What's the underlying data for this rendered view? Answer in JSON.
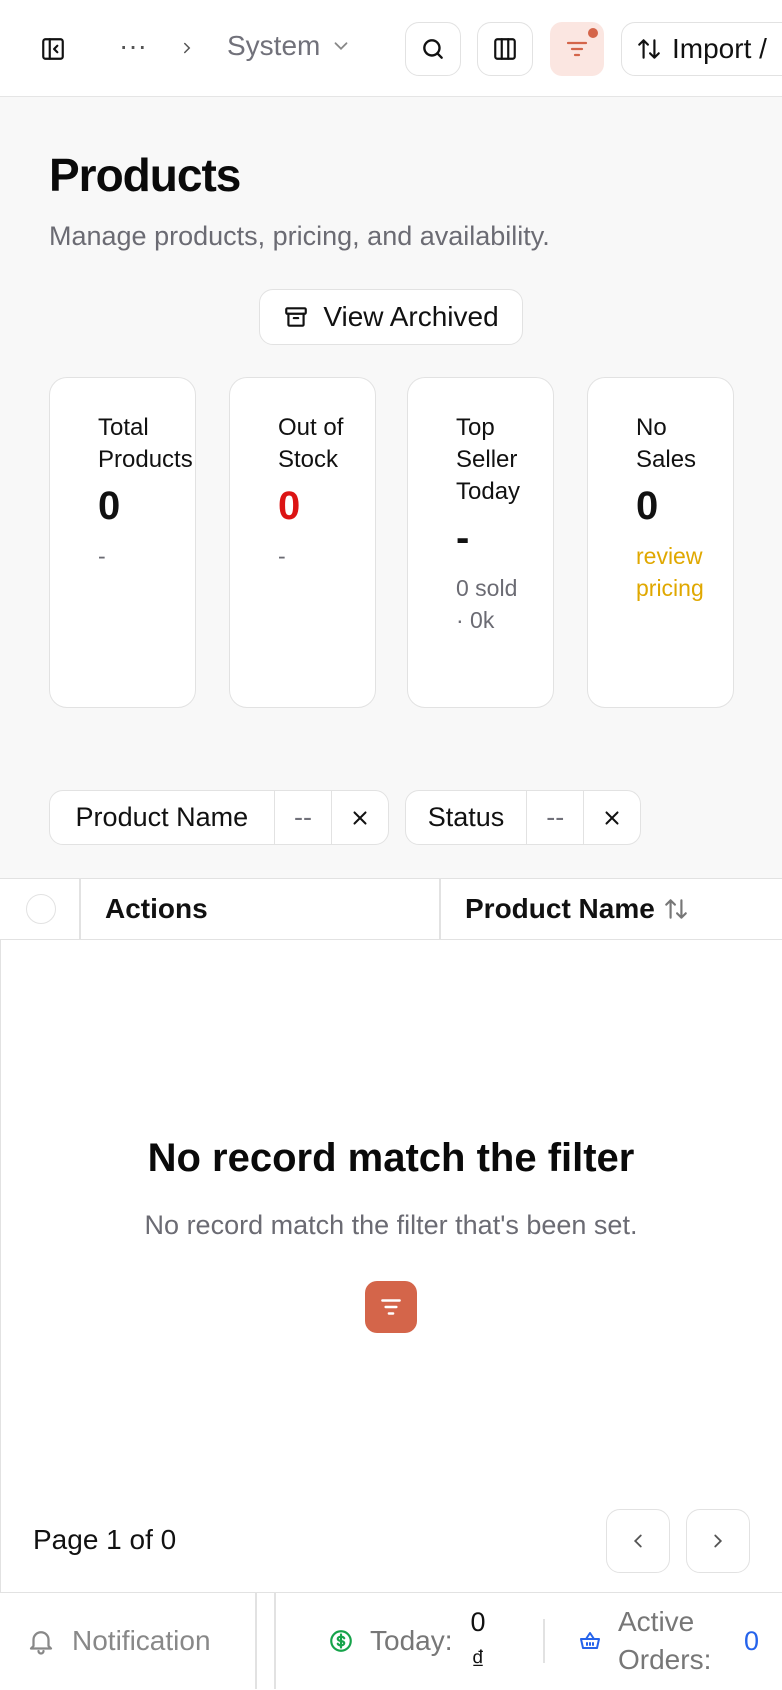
{
  "header": {
    "breadcrumb_more": "···",
    "breadcrumb_current": "System",
    "import_label": "Import /"
  },
  "page": {
    "title": "Products",
    "subtitle": "Manage products, pricing, and availability.",
    "view_archived_label": "View Archived"
  },
  "stats": [
    {
      "label": "Total Products",
      "value": "0",
      "sub": "-"
    },
    {
      "label": "Out of Stock",
      "value": "0",
      "sub": "-"
    },
    {
      "label": "Top Seller Today",
      "value": "-",
      "sub": "0 sold · 0k"
    },
    {
      "label": "No Sales",
      "value": "0",
      "sub": "review pricing"
    }
  ],
  "filters": [
    {
      "field": "Product Name",
      "value": "--"
    },
    {
      "field": "Status",
      "value": "--"
    }
  ],
  "table": {
    "columns": [
      "Actions",
      "Product Name"
    ],
    "empty_title": "No record match the filter",
    "empty_subtitle": "No record match the filter that's been set."
  },
  "pagination": {
    "text": "Page 1 of 0"
  },
  "footer": {
    "notification_label": "Notification",
    "today_label": "Today:",
    "today_value": "0",
    "currency": "₫",
    "active_orders_label": "Active Orders:",
    "active_orders_value": "0"
  },
  "colors": {
    "danger": "#dc1414",
    "warning": "#e0a800",
    "accent": "#d4654a",
    "success": "#16a34a",
    "link": "#2563eb"
  }
}
